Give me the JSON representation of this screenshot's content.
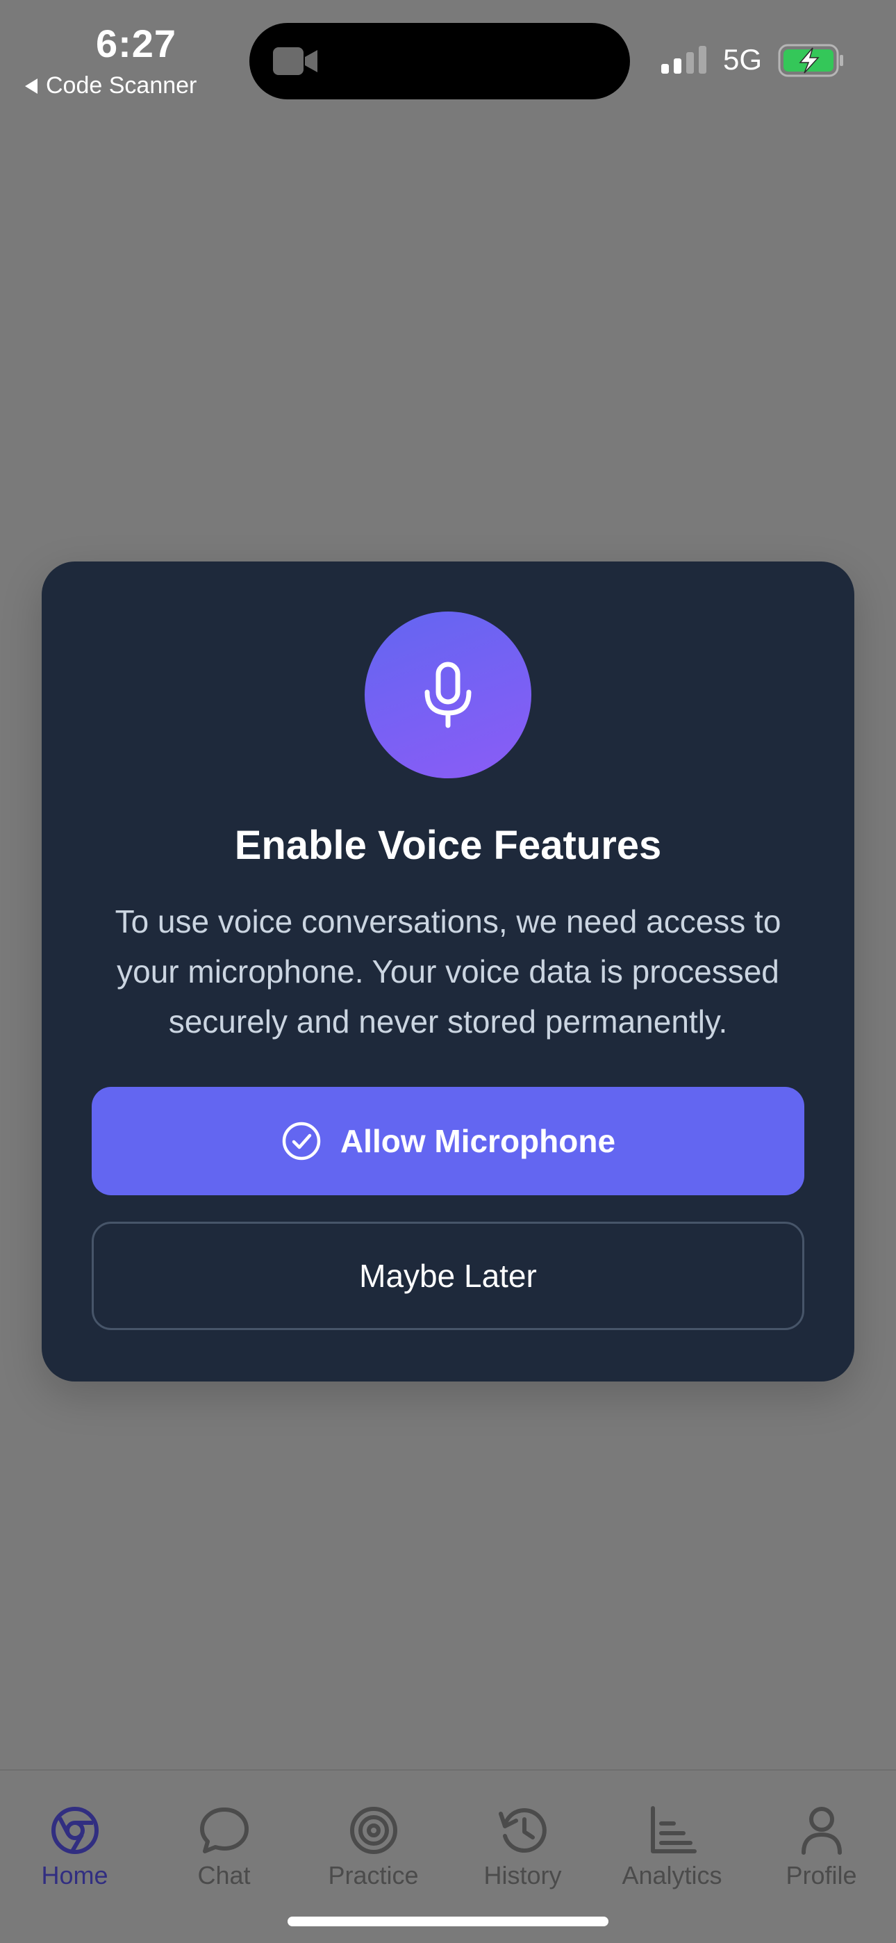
{
  "status_bar": {
    "time": "6:27",
    "back_app": "Code Scanner",
    "network": "5G"
  },
  "modal": {
    "icon": "microphone-icon",
    "title": "Enable Voice Features",
    "description": "To use voice conversations, we need access to your microphone. Your voice data is processed securely and never stored permanently.",
    "allow_button": "Allow Microphone",
    "later_button": "Maybe Later"
  },
  "tabbar": {
    "active": "Home",
    "items": [
      {
        "label": "Home",
        "icon": "home-icon"
      },
      {
        "label": "Chat",
        "icon": "chat-bubble-icon"
      },
      {
        "label": "Practice",
        "icon": "target-icon"
      },
      {
        "label": "History",
        "icon": "history-icon"
      },
      {
        "label": "Analytics",
        "icon": "bar-chart-icon"
      },
      {
        "label": "Profile",
        "icon": "person-icon"
      }
    ]
  },
  "colors": {
    "overlay": "#7a7a7a",
    "modal_bg": "#1e293b",
    "accent": "#6366f1",
    "accent_gradient_end": "#8b5cf6",
    "active_tab": "#312e81"
  }
}
